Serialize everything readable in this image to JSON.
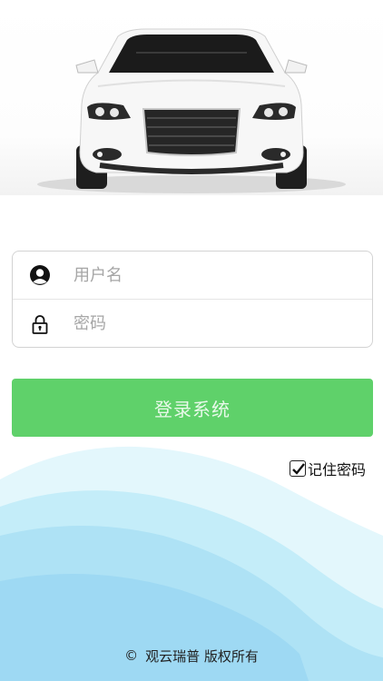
{
  "login_form": {
    "username_placeholder": "用户名",
    "password_placeholder": "密码",
    "username_icon": "user-icon",
    "password_icon": "lock-icon"
  },
  "login_button": {
    "label": "登录系统"
  },
  "remember_password": {
    "label": "记住密码",
    "checked": true
  },
  "footer": {
    "copyright_symbol": "©",
    "text": "观云瑞普 版权所有"
  },
  "colors": {
    "primary_button": "#5fd16a",
    "wave_light": "#d6f3fb",
    "wave_mid": "#b5e6f7",
    "wave_deep": "#9ed9f3"
  }
}
